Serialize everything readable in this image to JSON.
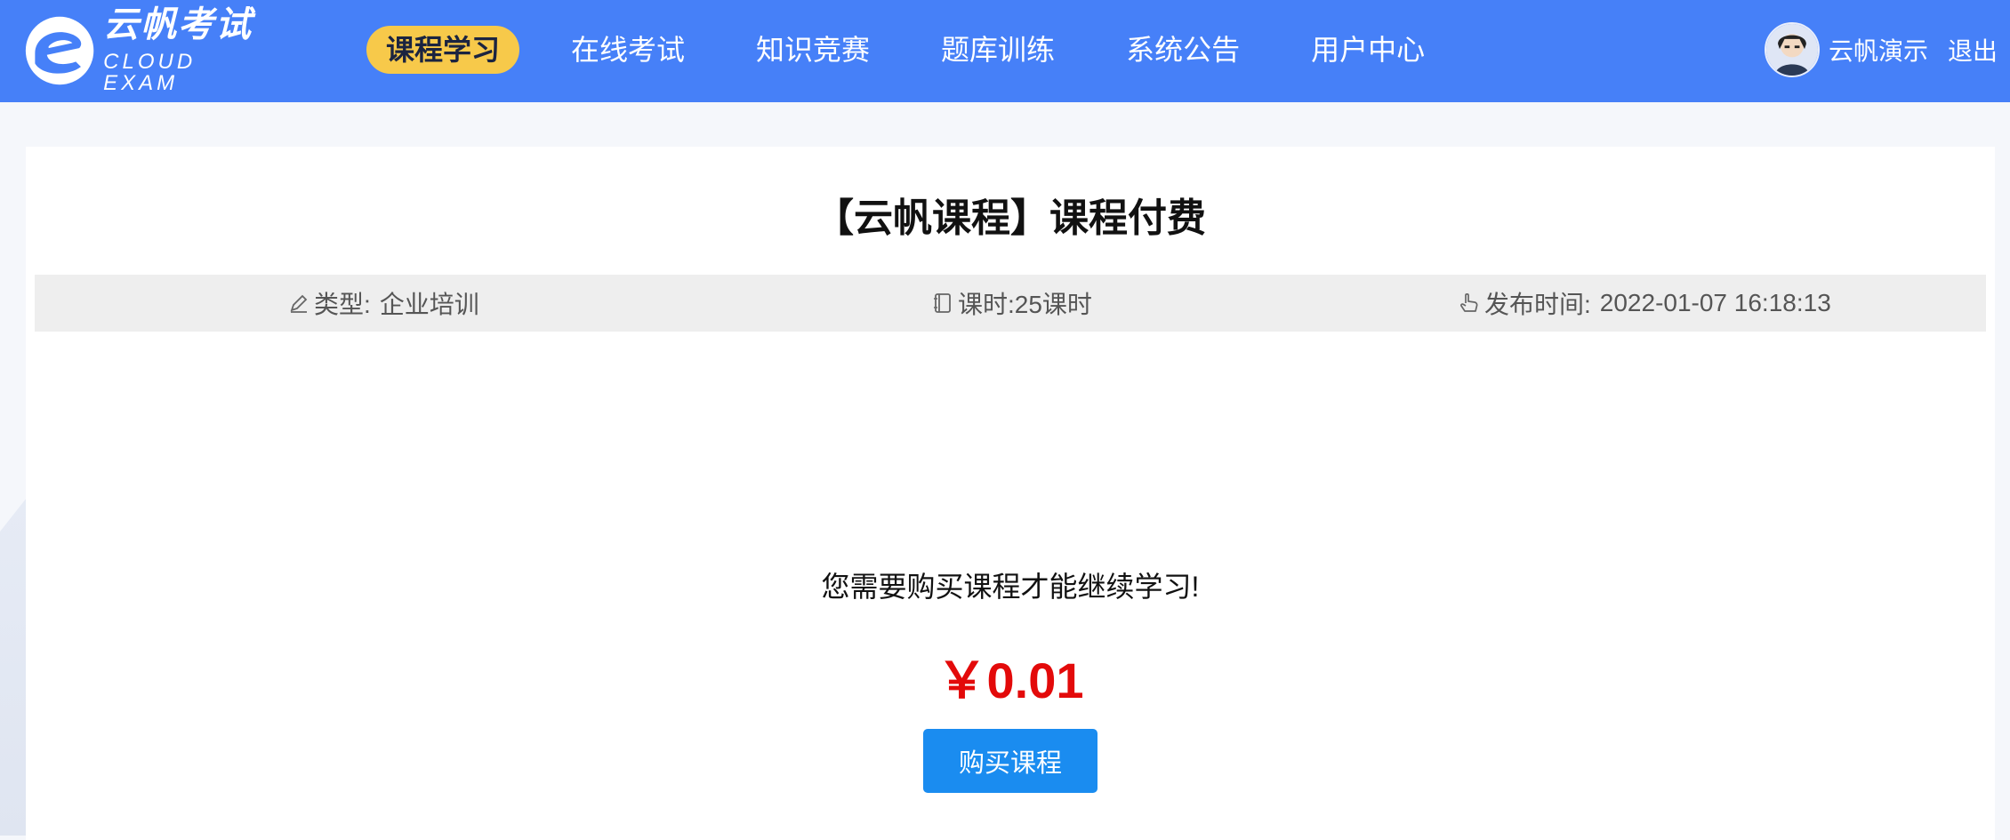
{
  "header": {
    "logo_cn": "云帆考试",
    "logo_en": "CLOUD EXAM",
    "nav": [
      {
        "label": "课程学习",
        "active": true
      },
      {
        "label": "在线考试",
        "active": false
      },
      {
        "label": "知识竞赛",
        "active": false
      },
      {
        "label": "题库训练",
        "active": false
      },
      {
        "label": "系统公告",
        "active": false
      },
      {
        "label": "用户中心",
        "active": false
      }
    ],
    "username": "云帆演示",
    "logout_label": "退出"
  },
  "course": {
    "title": "【云帆课程】课程付费",
    "type_label": "类型:",
    "type_value": "企业培训",
    "hours_label": "课时:",
    "hours_value": "25课时",
    "publish_label": "发布时间:",
    "publish_value": "2022-01-07 16:18:13"
  },
  "purchase": {
    "notice": "您需要购买课程才能继续学习!",
    "price": "￥0.01",
    "button_label": "购买课程"
  },
  "colors": {
    "header_bg": "#4680f8",
    "nav_active_bg": "#f7c94a",
    "price": "#e30a0a",
    "button_bg": "#1a8cf0"
  }
}
